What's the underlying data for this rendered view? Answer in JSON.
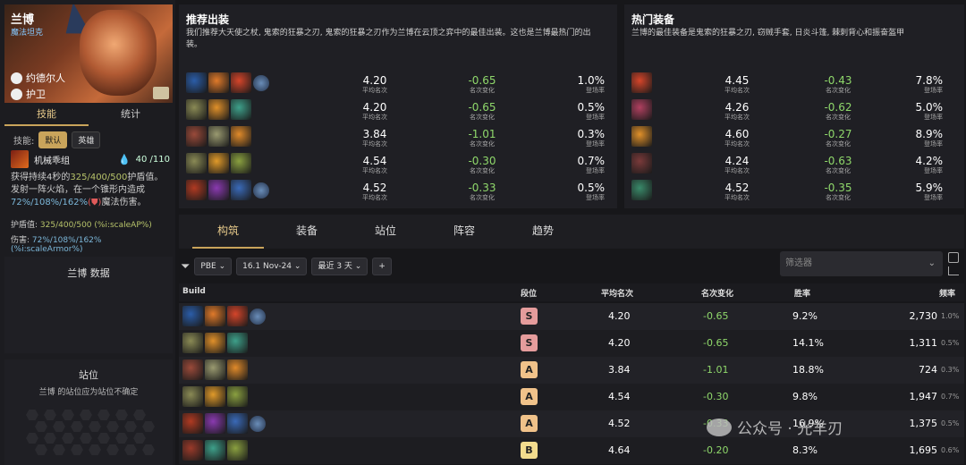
{
  "hero": {
    "name": "兰博",
    "subtitle": "魔法坦克",
    "trait1": "约德尔人",
    "trait2": "护卫"
  },
  "left_tabs": [
    "技能",
    "统计"
  ],
  "skill": {
    "label": "技能:",
    "pill_default": "默认",
    "pill_hero": "英雄",
    "name": "机械乖组",
    "mana": "40 /110",
    "desc_1": "获得持续4秒的",
    "desc_shield": "325/400/500",
    "desc_2": "护盾值。发射一阵火焰，在一个锥形内造成",
    "desc_dmg": "72%/108%/162%",
    "desc_3": "魔法伤害。",
    "shield_label": "护盾值:",
    "shield_val": "325/400/500 (%i:scaleAP%)",
    "dmg_label": "伤害:",
    "dmg_val": "72%/108%/162% (%i:scaleArmor%)"
  },
  "data_panel": {
    "title": "兰博 数据"
  },
  "position_panel": {
    "title": "站位",
    "subtitle": "兰博 的站位应为站位不确定"
  },
  "recommended": {
    "title": "推荐出装",
    "desc": "我们推荐大天使之杖, 鬼索的狂暴之刃, 鬼索的狂暴之刃作为兰博在云顶之弈中的最佳出装。这也是兰博最热门的出装。",
    "rows": [
      {
        "avg": "4.20",
        "chg": "-0.65",
        "rate": "1.0%"
      },
      {
        "avg": "4.20",
        "chg": "-0.65",
        "rate": "0.5%"
      },
      {
        "avg": "3.84",
        "chg": "-1.01",
        "rate": "0.3%"
      },
      {
        "avg": "4.54",
        "chg": "-0.30",
        "rate": "0.7%"
      },
      {
        "avg": "4.52",
        "chg": "-0.33",
        "rate": "0.5%"
      }
    ]
  },
  "hot": {
    "title": "热门装备",
    "desc": "兰博的最佳装备是鬼索的狂暴之刃, 窃贼手套, 日炎斗篷, 棘刺背心和振奋盔甲",
    "rows": [
      {
        "avg": "4.45",
        "chg": "-0.43",
        "rate": "7.8%"
      },
      {
        "avg": "4.26",
        "chg": "-0.62",
        "rate": "5.0%"
      },
      {
        "avg": "4.60",
        "chg": "-0.27",
        "rate": "8.9%"
      },
      {
        "avg": "4.24",
        "chg": "-0.63",
        "rate": "4.2%"
      },
      {
        "avg": "4.52",
        "chg": "-0.35",
        "rate": "5.9%"
      }
    ]
  },
  "labels": {
    "avg": "平均名次",
    "chg": "名次变化",
    "rate": "登场率"
  },
  "nav_tabs": [
    "构筑",
    "装备",
    "站位",
    "阵容",
    "趋势"
  ],
  "filters": {
    "server": "PBE",
    "patch": "16.1 Nov-24",
    "range": "最近 3 天",
    "add": "+",
    "search_placeholder": "筛选器"
  },
  "table": {
    "headers": [
      "Build",
      "段位",
      "平均名次",
      "名次变化",
      "胜率",
      "频率"
    ],
    "rows": [
      {
        "grade": "S",
        "avg": "4.20",
        "chg": "-0.65",
        "win": "9.2%",
        "freq": "2,730",
        "freq_pct": "1.0%"
      },
      {
        "grade": "S",
        "avg": "4.20",
        "chg": "-0.65",
        "win": "14.1%",
        "freq": "1,311",
        "freq_pct": "0.5%"
      },
      {
        "grade": "A",
        "avg": "3.84",
        "chg": "-1.01",
        "win": "18.8%",
        "freq": "724",
        "freq_pct": "0.3%"
      },
      {
        "grade": "A",
        "avg": "4.54",
        "chg": "-0.30",
        "win": "9.8%",
        "freq": "1,947",
        "freq_pct": "0.7%"
      },
      {
        "grade": "A",
        "avg": "4.52",
        "chg": "-0.33",
        "win": "16.9%",
        "freq": "1,375",
        "freq_pct": "0.5%"
      },
      {
        "grade": "B",
        "avg": "4.64",
        "chg": "-0.20",
        "win": "8.3%",
        "freq": "1,695",
        "freq_pct": "0.6%"
      }
    ]
  },
  "watermark": "公众号 · 光羊刃",
  "colors": {
    "accent": "#c9a45b",
    "positive": "#8fd86b",
    "grade_S": "#e59c9c",
    "grade_A": "#f0c28a",
    "grade_B": "#f2dc8e"
  }
}
